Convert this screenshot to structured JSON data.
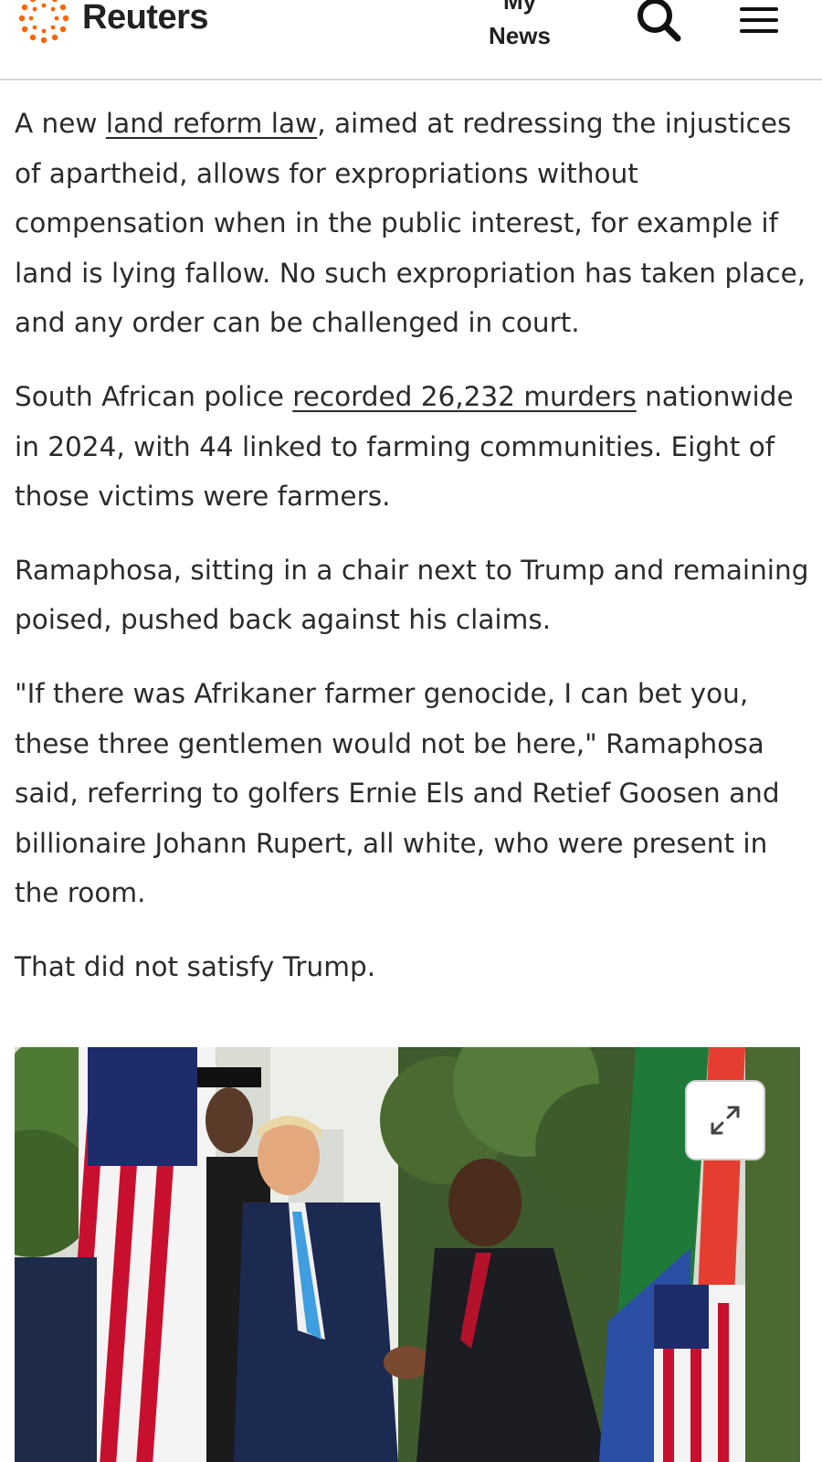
{
  "header": {
    "brand": "Reuters",
    "my_news_line1": "My",
    "my_news_line2": "News",
    "search_icon": "search-icon",
    "menu_icon": "hamburger-menu-icon",
    "brand_color": "#fa6400"
  },
  "article": {
    "p1": {
      "before": "A new ",
      "link": "land reform law",
      "after": ", aimed at redressing the injustices of apartheid, allows for expropriations without compensation when in the public interest, for example if land is lying fallow. No such expropriation has taken place, and any order can be challenged in court."
    },
    "p2": {
      "before": "South African police ",
      "link": "recorded 26,232 murders",
      "after": " nationwide in 2024, with 44 linked to farming communities. Eight of those victims were farmers."
    },
    "p3": "Ramaphosa, sitting in a chair next to Trump and remaining poised, pushed back against his claims.",
    "p4": "\"If there was Afrikaner farmer genocide, I can bet you, these three gentlemen would not be here,\" Ramaphosa said, referring to golfers Ernie Els and Retief Goosen and billionaire Johann Rupert, all white, who were present in the room.",
    "p5": "That did not satisfy Trump."
  },
  "figure": {
    "expand_icon": "expand-icon"
  }
}
